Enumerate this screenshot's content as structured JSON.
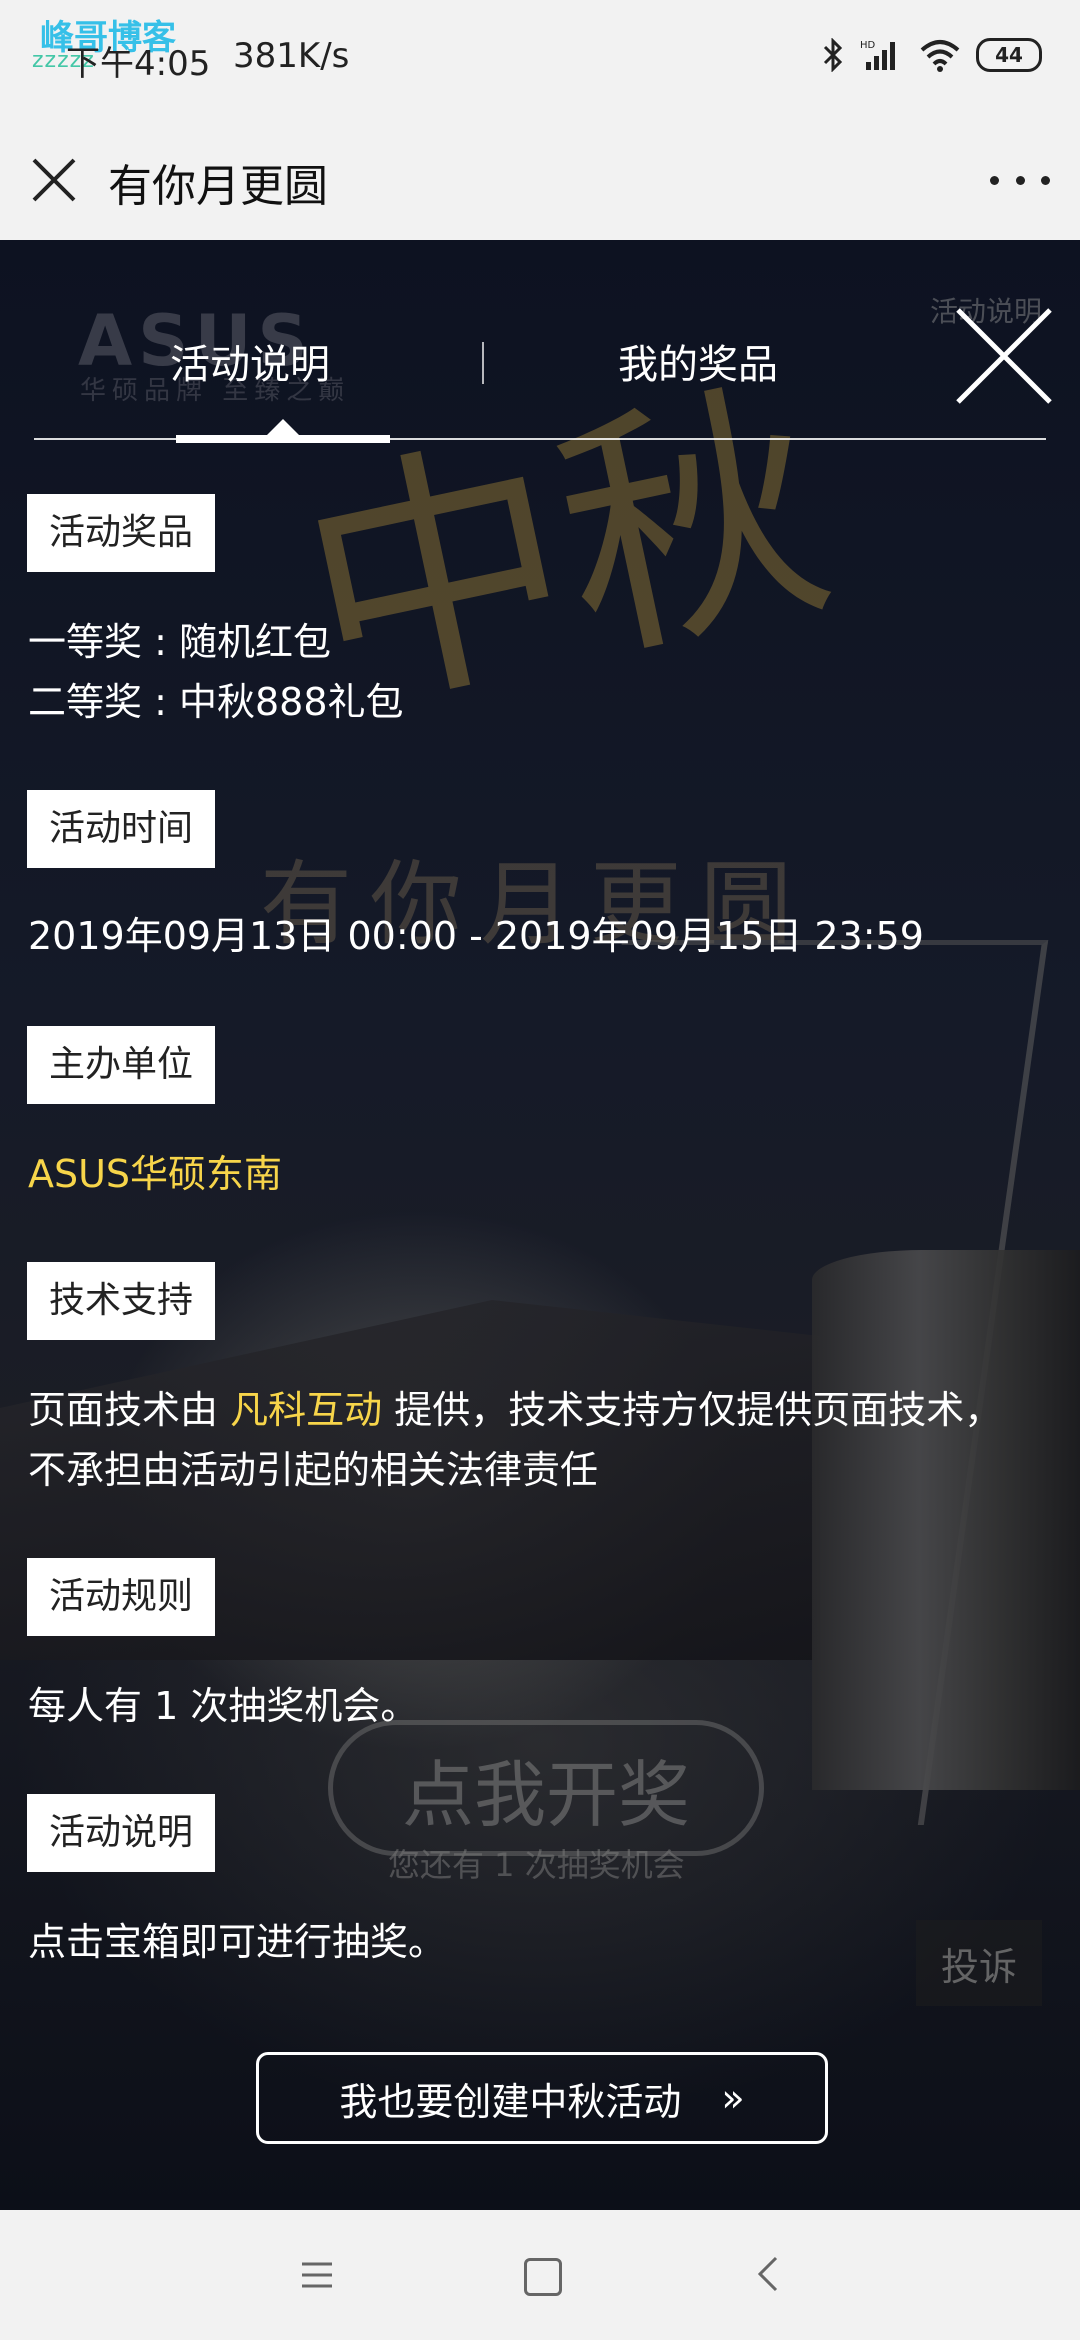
{
  "status_bar": {
    "watermark_top": "峰哥博客",
    "watermark_bottom": "zzzzz",
    "time": "下午4:05",
    "net_speed": "381K/s",
    "signal_label": "HD",
    "battery": "44"
  },
  "title_bar": {
    "title": "有你月更圆"
  },
  "tabs": {
    "items": [
      "活动说明",
      "我的奖品"
    ],
    "active_index": 0
  },
  "background": {
    "brand": "ASUS",
    "brand_sub": "华硕品牌 至臻之巅",
    "calligraphy": "中秋",
    "poster_title": "有你月更圆",
    "audio_label": "活动说明",
    "draw_button": "点我开奖",
    "chance_text": "您还有 1 次抽奖机会",
    "complain": "投诉"
  },
  "sections": {
    "prize": {
      "label": "活动奖品",
      "lines": [
        "一等奖 : 随机红包",
        "二等奖 : 中秋888礼包"
      ]
    },
    "time": {
      "label": "活动时间",
      "text": "2019年09月13日 00:00 - 2019年09月15日 23:59"
    },
    "organizer": {
      "label": "主办单位",
      "text": "ASUS华硕东南"
    },
    "tech": {
      "label": "技术支持",
      "prefix": "页面技术由 ",
      "highlight": "凡科互动",
      "suffix": " 提供，技术支持方仅提供页面技术，",
      "line2": "不承担由活动引起的相关法律责任"
    },
    "rules": {
      "label": "活动规则",
      "text": "每人有 1 次抽奖机会。"
    },
    "description": {
      "label": "活动说明",
      "text": "点击宝箱即可进行抽奖。"
    }
  },
  "create_button": {
    "label": "我也要创建中秋活动",
    "arrow": "»"
  },
  "colors": {
    "highlight": "#f7d54a",
    "status_bar_bg": "#f2f2f2",
    "content_bg": "#0e1220"
  }
}
